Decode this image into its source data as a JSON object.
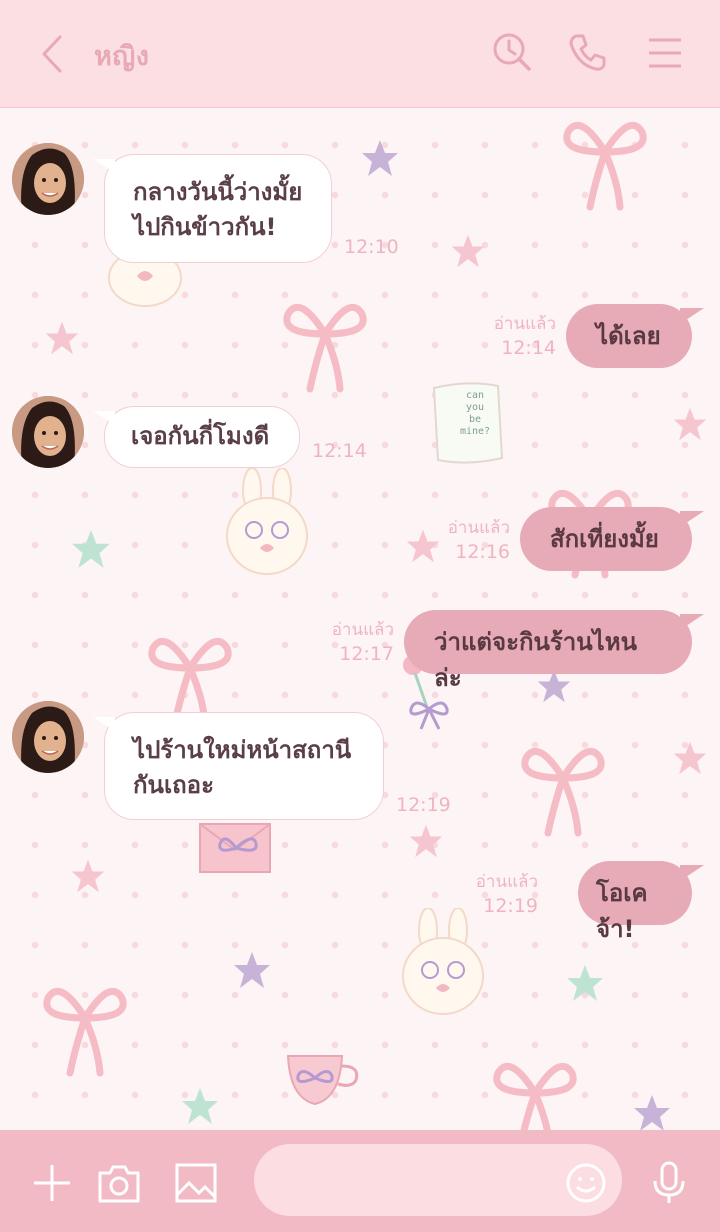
{
  "header": {
    "title": "หญิง",
    "icons": [
      "back-chevron-icon",
      "search-history-icon",
      "phone-icon",
      "menu-icon"
    ]
  },
  "messages": [
    {
      "side": "in",
      "text_lines": [
        "กลางวันนี้ว่างมั้ย",
        "ไปกินข้าวกัน!"
      ],
      "time": "12:10"
    },
    {
      "side": "out",
      "text": "ได้เลย",
      "read": "อ่านแล้ว",
      "time": "12:14"
    },
    {
      "side": "in",
      "text_lines": [
        "เจอกันกี่โมงดี"
      ],
      "time": "12:14"
    },
    {
      "side": "out",
      "text": "สักเที่ยงมั้ย",
      "read": "อ่านแล้ว",
      "time": "12:16"
    },
    {
      "side": "out",
      "text": "ว่าแต่จะกินร้านไหนล่ะ",
      "read": "อ่านแล้ว",
      "time": "12:17"
    },
    {
      "side": "in",
      "text_lines": [
        "ไปร้านใหม่หน้าสถานี",
        "กันเถอะ"
      ],
      "time": "12:19"
    },
    {
      "side": "out",
      "text": "โอเคจ้า!",
      "read": "อ่านแล้ว",
      "time": "12:19"
    }
  ],
  "sticker_text": [
    "can",
    "you",
    "be",
    "mine?"
  ],
  "composer": {
    "placeholder": "",
    "icons": [
      "plus-icon",
      "camera-icon",
      "image-icon",
      "emoji-icon",
      "microphone-icon"
    ]
  },
  "colors": {
    "header_bg": "#fcdfe3",
    "accent": "#e8a9b4",
    "outgoing_bubble": "#e7aab7",
    "incoming_bubble": "#ffffff",
    "bottom_bar": "#f2bac5"
  }
}
